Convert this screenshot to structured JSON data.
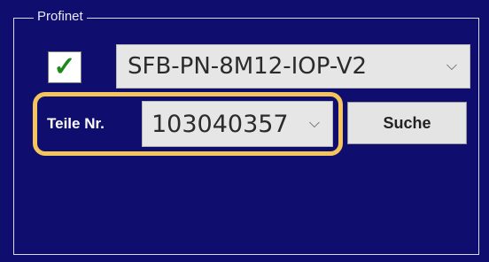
{
  "group": {
    "title": "Profinet"
  },
  "checkbox": {
    "checked": true,
    "icon": "check-icon",
    "glyph": "✓"
  },
  "device_select": {
    "value": "SFB-PN-8M12-IOP-V2",
    "icon": "chevron-down-icon",
    "chevron": "⌵"
  },
  "part_number": {
    "label": "Teile Nr.",
    "value": "103040357",
    "icon": "chevron-down-icon",
    "chevron": "⌵"
  },
  "search_button": {
    "label": "Suche"
  },
  "colors": {
    "panel_background": "#0f0e6e",
    "highlight": "#f3c55b",
    "check": "#1a8a1a"
  }
}
